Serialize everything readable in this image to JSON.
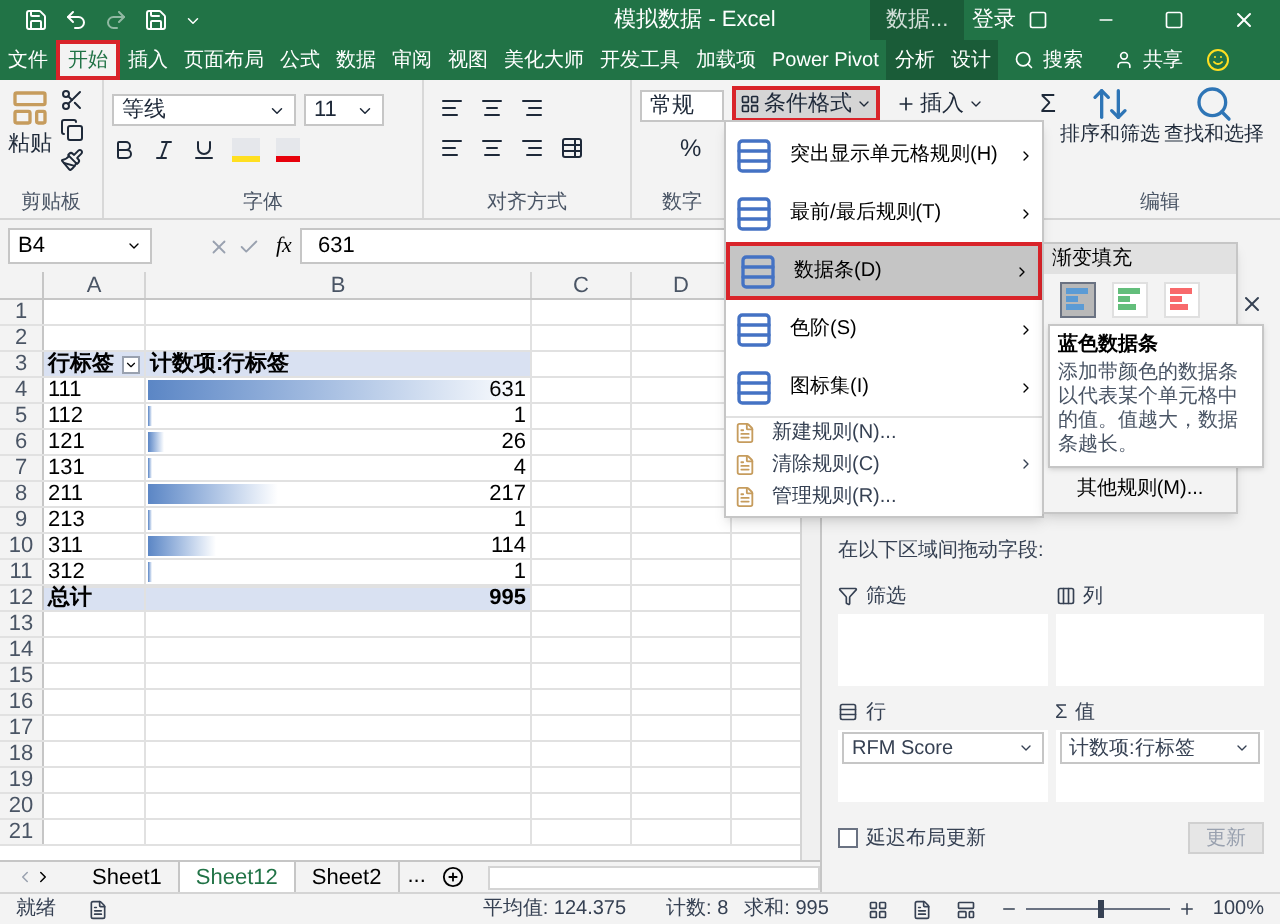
{
  "title_bar": {
    "title": "模拟数据 - Excel",
    "context_label": "数据...",
    "sign_in": "登录"
  },
  "menu_tabs": [
    {
      "label": "文件",
      "selected": false,
      "contextual": false
    },
    {
      "label": "开始",
      "selected": true,
      "contextual": false
    },
    {
      "label": "插入",
      "selected": false,
      "contextual": false
    },
    {
      "label": "页面布局",
      "selected": false,
      "contextual": false
    },
    {
      "label": "公式",
      "selected": false,
      "contextual": false
    },
    {
      "label": "数据",
      "selected": false,
      "contextual": false
    },
    {
      "label": "审阅",
      "selected": false,
      "contextual": false
    },
    {
      "label": "视图",
      "selected": false,
      "contextual": false
    },
    {
      "label": "美化大师",
      "selected": false,
      "contextual": false
    },
    {
      "label": "开发工具",
      "selected": false,
      "contextual": false
    },
    {
      "label": "加载项",
      "selected": false,
      "contextual": false
    },
    {
      "label": "Power Pivot",
      "selected": false,
      "contextual": false
    },
    {
      "label": "分析",
      "selected": false,
      "contextual": true
    },
    {
      "label": "设计",
      "selected": false,
      "contextual": true
    }
  ],
  "tell_me": "搜索",
  "share": "共享",
  "ribbon": {
    "paste": "粘贴",
    "clipboard_label": "剪贴板",
    "font_name": "等线",
    "font_size": "11",
    "font_label": "字体",
    "alignment_label": "对齐方式",
    "number_format": "常规",
    "percent": "%",
    "number_label": "数字",
    "conditional_format": "条件格式",
    "insert": "插入",
    "sum": "Σ",
    "sort_filter": "排序和筛选",
    "find_select": "查找和选择",
    "editing_label": "编辑"
  },
  "formula_bar": {
    "name_box": "B4",
    "fx": "fx",
    "value": "631"
  },
  "columns": [
    "A",
    "B",
    "C",
    "D"
  ],
  "row_numbers": [
    "1",
    "2",
    "3",
    "4",
    "5",
    "6",
    "7",
    "8",
    "9",
    "10",
    "11",
    "12",
    "13",
    "14",
    "15",
    "16",
    "17",
    "18",
    "19",
    "20",
    "21"
  ],
  "pivot": {
    "header_label": "行标签",
    "header_value": "计数项:行标签",
    "rows": [
      {
        "label": "111",
        "value": "631",
        "level": 1
      },
      {
        "label": "112",
        "value": "1",
        "level": 0.002
      },
      {
        "label": "121",
        "value": "26",
        "level": 0.041
      },
      {
        "label": "131",
        "value": "4",
        "level": 0.006
      },
      {
        "label": "211",
        "value": "217",
        "level": 0.344
      },
      {
        "label": "213",
        "value": "1",
        "level": 0.002
      },
      {
        "label": "311",
        "value": "114",
        "level": 0.181
      },
      {
        "label": "312",
        "value": "1",
        "level": 0.002
      }
    ],
    "total_label": "总计",
    "total_value": "995"
  },
  "cf_menu": {
    "items": [
      {
        "label": "突出显示单元格规则(H)",
        "kind": "large",
        "submenu": true,
        "selected": false
      },
      {
        "label": "最前/最后规则(T)",
        "kind": "large",
        "submenu": true,
        "selected": false
      },
      {
        "label": "数据条(D)",
        "kind": "large",
        "submenu": true,
        "selected": true
      },
      {
        "label": "色阶(S)",
        "kind": "large",
        "submenu": true,
        "selected": false
      },
      {
        "label": "图标集(I)",
        "kind": "large",
        "submenu": true,
        "selected": false
      },
      {
        "label": "新建规则(N)...",
        "kind": "small",
        "submenu": false,
        "selected": false
      },
      {
        "label": "清除规则(C)",
        "kind": "small",
        "submenu": true,
        "selected": false
      },
      {
        "label": "管理规则(R)...",
        "kind": "small",
        "submenu": false,
        "selected": false
      }
    ]
  },
  "databar_submenu": {
    "heading": "渐变填充",
    "swatches": [
      {
        "color": "#5b9bd5",
        "selected": true
      },
      {
        "color": "#63be7b",
        "selected": false
      },
      {
        "color": "#f8696b",
        "selected": false
      }
    ],
    "more": "其他规则(M)..."
  },
  "tooltip": {
    "title": "蓝色数据条",
    "text": "添加带颜色的数据条以代表某个单元格中的值。值越大，数据条越长。"
  },
  "field_pane": {
    "instruction": "在以下区域间拖动字段:",
    "areas": [
      {
        "kind": "filter",
        "label": "筛选"
      },
      {
        "kind": "columns",
        "label": "列"
      },
      {
        "kind": "rows",
        "label": "行",
        "field": "RFM Score"
      },
      {
        "kind": "values",
        "label": "值",
        "field": "计数项:行标签"
      }
    ],
    "defer": {
      "label": "延迟布局更新",
      "checked": false
    },
    "update": "更新"
  },
  "sheets": [
    {
      "label": "Sheet1",
      "selected": false
    },
    {
      "label": "Sheet12",
      "selected": true
    },
    {
      "label": "Sheet2",
      "selected": false
    }
  ],
  "sheets_more": "...",
  "status": {
    "ready": "就绪",
    "average": "平均值: 124.375",
    "count": "计数: 8",
    "sum": "求和: 995",
    "zoom": "100%",
    "zoom_slider": {
      "level": 0.5
    }
  },
  "values_icon": "Σ"
}
